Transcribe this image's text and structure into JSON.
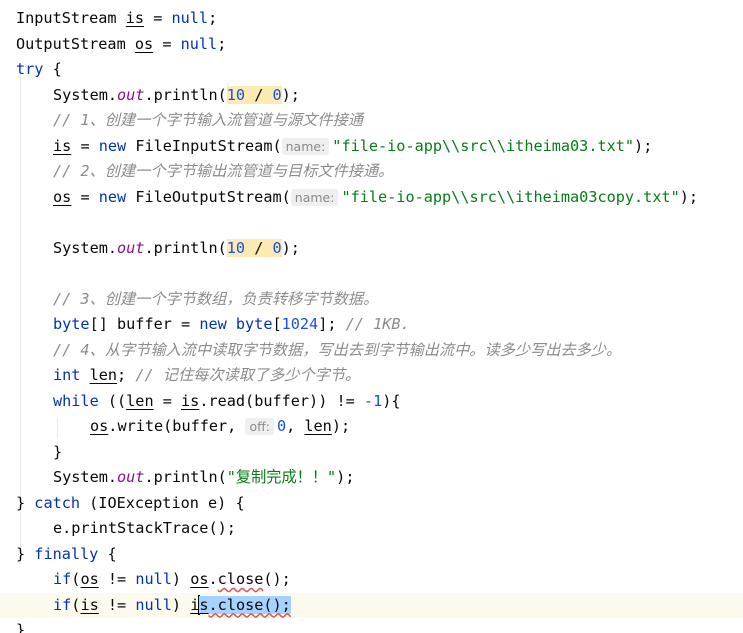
{
  "code": {
    "line1": {
      "type": "InputStream",
      "var": "is",
      "eq": " = ",
      "null": "null",
      "end": ";"
    },
    "line2": {
      "type": "OutputStream",
      "var": "os",
      "eq": " = ",
      "null": "null",
      "end": ";"
    },
    "line3": {
      "kw": "try",
      "rest": " {"
    },
    "line4": {
      "sys": "System.",
      "out": "out",
      "println": ".println(",
      "num1": "10",
      "op": " / ",
      "num2": "0",
      "end": ");"
    },
    "line5": {
      "comment": "// 1、创建一个字节输入流管道与源文件接通"
    },
    "line6": {
      "var": "is",
      "eq": " = ",
      "new": "new",
      "cls": " FileInputStream(",
      "hint": "name:",
      "str": "\"file-io-app\\\\src\\\\itheima03.txt\"",
      "end": ");"
    },
    "line7": {
      "comment": "// 2、创建一个字节输出流管道与目标文件接通。"
    },
    "line8": {
      "var": "os",
      "eq": " = ",
      "new": "new",
      "cls": " FileOutputStream(",
      "hint": "name:",
      "str": "\"file-io-app\\\\src\\\\itheima03copy.txt\"",
      "end": ");"
    },
    "line10": {
      "sys": "System.",
      "out": "out",
      "println": ".println(",
      "num1": "10",
      "op": " / ",
      "num2": "0",
      "end": ");"
    },
    "line12": {
      "comment": "// 3、创建一个字节数组，负责转移字节数据。"
    },
    "line13": {
      "kw": "byte",
      "arr": "[] buffer = ",
      "new": "new",
      "kw2": " byte",
      "bracket": "[",
      "num": "1024",
      "end": "]; ",
      "comment": "// 1KB."
    },
    "line14": {
      "comment": "// 4、从字节输入流中读取字节数据，写出去到字节输出流中。读多少写出去多少。"
    },
    "line15": {
      "kw": "int",
      "sp": " ",
      "var": "len",
      "semi": "; ",
      "comment": "// 记住每次读取了多少个字节。"
    },
    "line16": {
      "kw": "while",
      "open": " ((",
      "len": "len",
      "eq": " = ",
      "is": "is",
      "read": ".read(buffer)) != ",
      "num": "-1",
      "end": "){"
    },
    "line17": {
      "os": "os",
      "write": ".write(buffer, ",
      "hint": "off:",
      "num": "0",
      "comma": ", ",
      "len": "len",
      "end": ");"
    },
    "line18": {
      "brace": "}"
    },
    "line19": {
      "sys": "System.",
      "out": "out",
      "println": ".println(",
      "str": "\"复制完成！！\"",
      "end": ");"
    },
    "line20": {
      "brace": "} ",
      "kw": "catch",
      "rest": " (IOException e) {"
    },
    "line21": {
      "text": "e.printStackTrace();"
    },
    "line22": {
      "brace": "} ",
      "kw": "finally",
      "rest": " {"
    },
    "line23": {
      "kw": "if",
      "open": "(",
      "os": "os",
      "ne": " != ",
      "null": "null",
      "close": ") ",
      "os2": "os",
      "dot": ".",
      "close_call": "close",
      "end": "();"
    },
    "line24": {
      "kw": "if",
      "open": "(",
      "is": "is",
      "ne": " != ",
      "null": "null",
      "close": ") ",
      "i": "i",
      "s": "s",
      "sel": ".close();"
    },
    "line25": {
      "brace": "}"
    }
  }
}
